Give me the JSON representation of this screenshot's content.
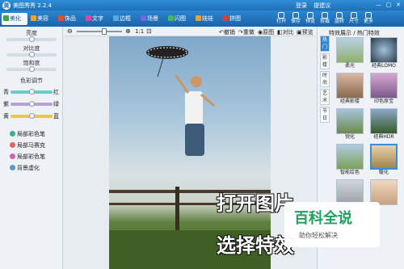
{
  "app": {
    "title": "美图秀秀 2.2.4",
    "links": [
      "登录",
      "提建议"
    ],
    "window_controls": [
      "—",
      "□",
      "✕"
    ]
  },
  "tabs": [
    {
      "label": "美化",
      "color": "#3fa34d"
    },
    {
      "label": "美容",
      "color": "#e8a23a"
    },
    {
      "label": "饰品",
      "color": "#d6533c"
    },
    {
      "label": "文字",
      "color": "#d64aa7"
    },
    {
      "label": "边框",
      "color": "#5aa7e0"
    },
    {
      "label": "场景",
      "color": "#6c6ce0"
    },
    {
      "label": "闪图",
      "color": "#46b36a"
    },
    {
      "label": "娃娃",
      "color": "#e0a040"
    },
    {
      "label": "拼图",
      "color": "#c44"
    }
  ],
  "right_toolbar": [
    "打开",
    "保存",
    "预览",
    "剪裁",
    "旋转",
    "尺寸",
    "更多"
  ],
  "left_panel": {
    "sliders": [
      {
        "label": "亮度",
        "level": 0.5
      },
      {
        "label": "对比度",
        "level": 0.5
      },
      {
        "label": "饱和度",
        "level": 0.5
      }
    ],
    "color_title": "色彩调节",
    "color_sliders": [
      {
        "left": "青",
        "right": "红",
        "level": 0.5,
        "color": "#3c9"
      },
      {
        "left": "紫",
        "right": "绿",
        "level": 0.5,
        "color": "#a6c"
      },
      {
        "left": "黄",
        "right": "蓝",
        "level": 0.5,
        "color": "#e6b800"
      }
    ],
    "functions": [
      {
        "label": "局部彩色笔",
        "color": "#4a9"
      },
      {
        "label": "局部马赛克",
        "color": "#d66"
      },
      {
        "label": "局部彩色笔",
        "color": "#c6a"
      },
      {
        "label": "背景虚化",
        "color": "#59c"
      }
    ]
  },
  "canvas_bar": {
    "zoom_label": "1:1",
    "zoom_level": 0.6,
    "buttons": [
      "撤销",
      "重做",
      "原图",
      "对比",
      "预览"
    ]
  },
  "right_panel": {
    "header": [
      "特效展示",
      "热门特效"
    ],
    "vertical_tabs": [
      "热门",
      "影楼",
      "时尚",
      "艺术",
      "节日"
    ],
    "effects": [
      "柔光",
      "经典LOMO",
      "经典影楼",
      "印色原宝",
      "锐化",
      "经典HDR",
      "智能绘色",
      "暖化",
      "",
      ""
    ]
  },
  "overlays": {
    "line1": "打开图片",
    "line2": "选择特效"
  },
  "watermark": {
    "title": "百科全说",
    "subtitle": "助你轻松解决"
  }
}
